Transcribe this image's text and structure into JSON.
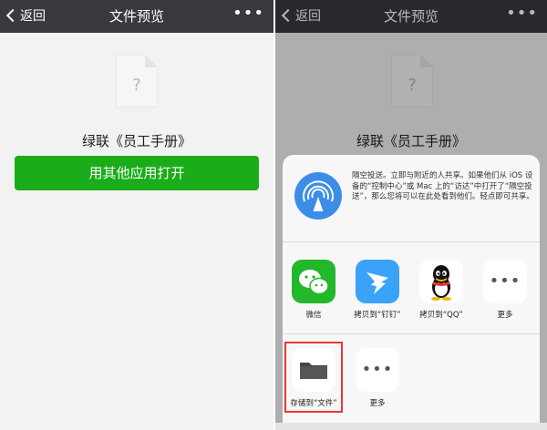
{
  "left": {
    "nav": {
      "back": "返回",
      "title": "文件预览",
      "more": "•••"
    },
    "file": {
      "icon_glyph": "?",
      "name": "绿联《员工手册》"
    },
    "open_button": "用其他应用打开"
  },
  "right": {
    "nav": {
      "back": "返回",
      "title": "文件预览",
      "more": "•••"
    },
    "file": {
      "icon_glyph": "?",
      "name": "绿联《员工手册》"
    },
    "airdrop": {
      "text": "隔空投送。立即与附近的人共享。如果他们从 iOS 设备的“控制中心”或 Mac 上的“访达”中打开了“隔空投送”，那么您将可以在此处看到他们。轻点即可共享。"
    },
    "apps": [
      {
        "label": "微信",
        "icon": "wechat-icon"
      },
      {
        "label": "拷贝到“钉钉”",
        "icon": "dingtalk-icon"
      },
      {
        "label": "拷贝到“QQ”",
        "icon": "qq-icon"
      },
      {
        "label": "更多",
        "icon": "more-dots-icon"
      }
    ],
    "actions": [
      {
        "label": "存储到“文件”",
        "icon": "folder-icon"
      },
      {
        "label": "更多",
        "icon": "more-dots-icon"
      }
    ]
  },
  "colors": {
    "nav_bg": "#393a3f",
    "open_button": "#1aad19",
    "highlight": "#e53935",
    "wechat": "#23b72a",
    "dingtalk": "#3aa3f7"
  }
}
